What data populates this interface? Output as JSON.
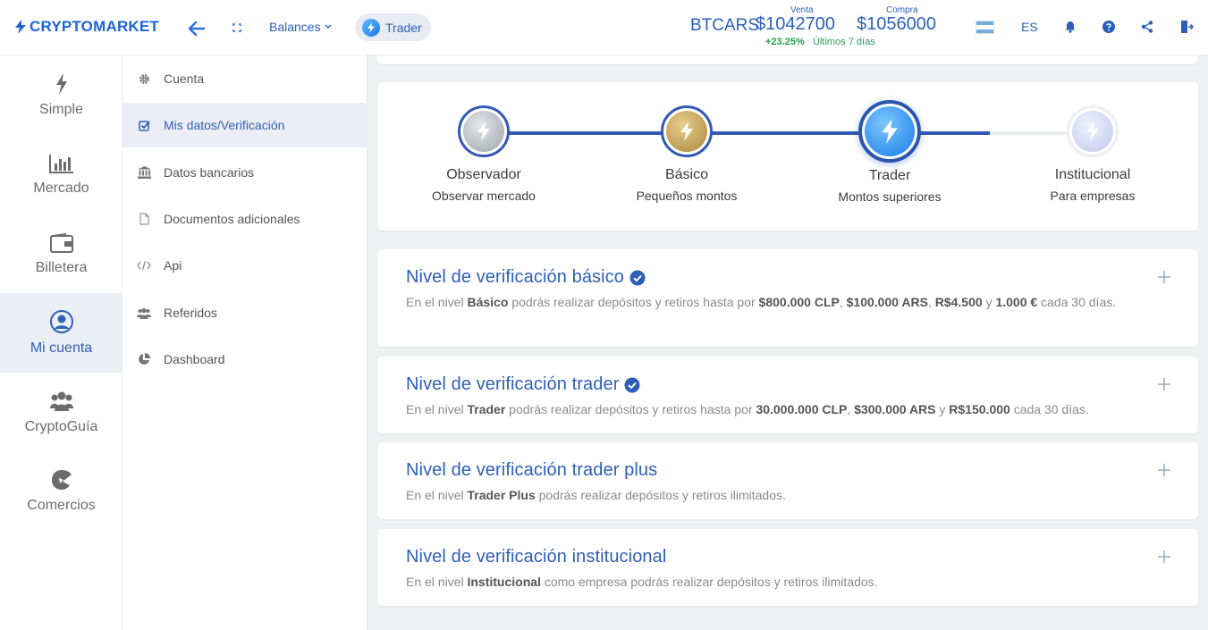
{
  "header": {
    "logo_text": "CRYPTOMARKET",
    "balances_label": "Balances",
    "trader_label": "Trader",
    "pair": "BTCARS",
    "sell_label": "Venta",
    "sell_value": "$1042700",
    "buy_label": "Compra",
    "buy_value": "$1056000",
    "change": "+23.25%",
    "period": "Últimos 7 días",
    "lang": "ES",
    "flag_colors": [
      "#74acdf",
      "#ffffff",
      "#74acdf"
    ]
  },
  "leftnav": {
    "items": [
      {
        "label": "Simple",
        "icon": "bolt-icon"
      },
      {
        "label": "Mercado",
        "icon": "bar-chart-icon"
      },
      {
        "label": "Billetera",
        "icon": "wallet-icon"
      },
      {
        "label": "Mi cuenta",
        "icon": "user-circle-icon",
        "active": true
      },
      {
        "label": "CryptoGuía",
        "icon": "users-icon"
      },
      {
        "label": "Comercios",
        "icon": "store-icon"
      }
    ]
  },
  "subnav": {
    "items": [
      {
        "label": "Cuenta",
        "icon": "gear-icon"
      },
      {
        "label": "Mis datos/Verificación",
        "icon": "checkbox-icon",
        "active": true
      },
      {
        "label": "Datos bancarios",
        "icon": "bank-icon"
      },
      {
        "label": "Documentos adicionales",
        "icon": "document-icon"
      },
      {
        "label": "Api",
        "icon": "code-icon"
      },
      {
        "label": "Referidos",
        "icon": "group-icon"
      },
      {
        "label": "Dashboard",
        "icon": "pie-chart-icon"
      }
    ]
  },
  "levels": [
    {
      "name": "Observador",
      "desc": "Observar mercado",
      "color": "#9ea3ad"
    },
    {
      "name": "Básico",
      "desc": "Pequeños montos",
      "color": "#b8974a"
    },
    {
      "name": "Trader",
      "desc": "Montos superiores",
      "color": "#1e8bf0"
    },
    {
      "name": "Institucional",
      "desc": "Para empresas",
      "color": "#c5cbee"
    }
  ],
  "verifications": [
    {
      "title": "Nivel de verificación básico",
      "verified": true,
      "desc_parts": [
        {
          "t": "En el nivel ",
          "b": false
        },
        {
          "t": "Básico",
          "b": true
        },
        {
          "t": " podrás realizar depósitos y retiros hasta por ",
          "b": false
        },
        {
          "t": "$800.000 CLP",
          "b": true
        },
        {
          "t": ", ",
          "b": false
        },
        {
          "t": "$100.000 ARS",
          "b": true
        },
        {
          "t": ", ",
          "b": false
        },
        {
          "t": "R$4.500",
          "b": true
        },
        {
          "t": " y ",
          "b": false
        },
        {
          "t": "1.000 €",
          "b": true
        },
        {
          "t": " cada 30 días.",
          "b": false
        }
      ]
    },
    {
      "title": "Nivel de verificación trader",
      "verified": true,
      "desc_parts": [
        {
          "t": "En el nivel ",
          "b": false
        },
        {
          "t": "Trader",
          "b": true
        },
        {
          "t": " podrás realizar depósitos y retiros hasta por ",
          "b": false
        },
        {
          "t": "30.000.000 CLP",
          "b": true
        },
        {
          "t": ", ",
          "b": false
        },
        {
          "t": "$300.000 ARS",
          "b": true
        },
        {
          "t": " y ",
          "b": false
        },
        {
          "t": "R$150.000",
          "b": true
        },
        {
          "t": " cada 30 días.",
          "b": false
        }
      ]
    },
    {
      "title": "Nivel de verificación trader plus",
      "verified": false,
      "desc_parts": [
        {
          "t": "En el nivel ",
          "b": false
        },
        {
          "t": "Trader Plus",
          "b": true
        },
        {
          "t": " podrás realizar depósitos y retiros ilimitados.",
          "b": false
        }
      ]
    },
    {
      "title": "Nivel de verificación institucional",
      "verified": false,
      "desc_parts": [
        {
          "t": "En el nivel ",
          "b": false
        },
        {
          "t": "Institucional",
          "b": true
        },
        {
          "t": " como empresa podrás realizar depósitos y retiros ilimitados.",
          "b": false
        }
      ]
    }
  ],
  "colors": {
    "accent": "#2d5fb8",
    "brand": "#1d64d8",
    "progress": "#3459b4",
    "positive": "#22a14a"
  }
}
